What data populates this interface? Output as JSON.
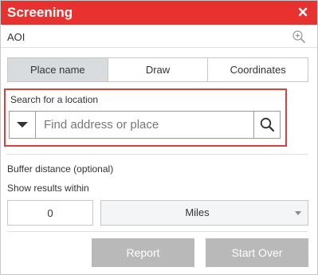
{
  "header": {
    "title": "Screening",
    "close_icon": "close-icon"
  },
  "aoi": {
    "label": "AOI",
    "icon": "zoom-in-icon"
  },
  "tabs": [
    {
      "label": "Place name",
      "active": true
    },
    {
      "label": "Draw",
      "active": false
    },
    {
      "label": "Coordinates",
      "active": false
    }
  ],
  "search": {
    "label": "Search for a location",
    "placeholder": "Find address or place",
    "value": "",
    "icons": {
      "dropdown": "caret-down-icon",
      "submit": "search-icon"
    }
  },
  "buffer": {
    "title": "Buffer distance (optional)",
    "within_label": "Show results within",
    "distance": "0",
    "unit": "Miles"
  },
  "actions": {
    "report": "Report",
    "start_over": "Start Over"
  },
  "colors": {
    "header_bg": "#e8322f",
    "highlight_border": "#d9413b",
    "active_tab": "#d9dcdf",
    "disabled_button": "#b9b9b9"
  }
}
